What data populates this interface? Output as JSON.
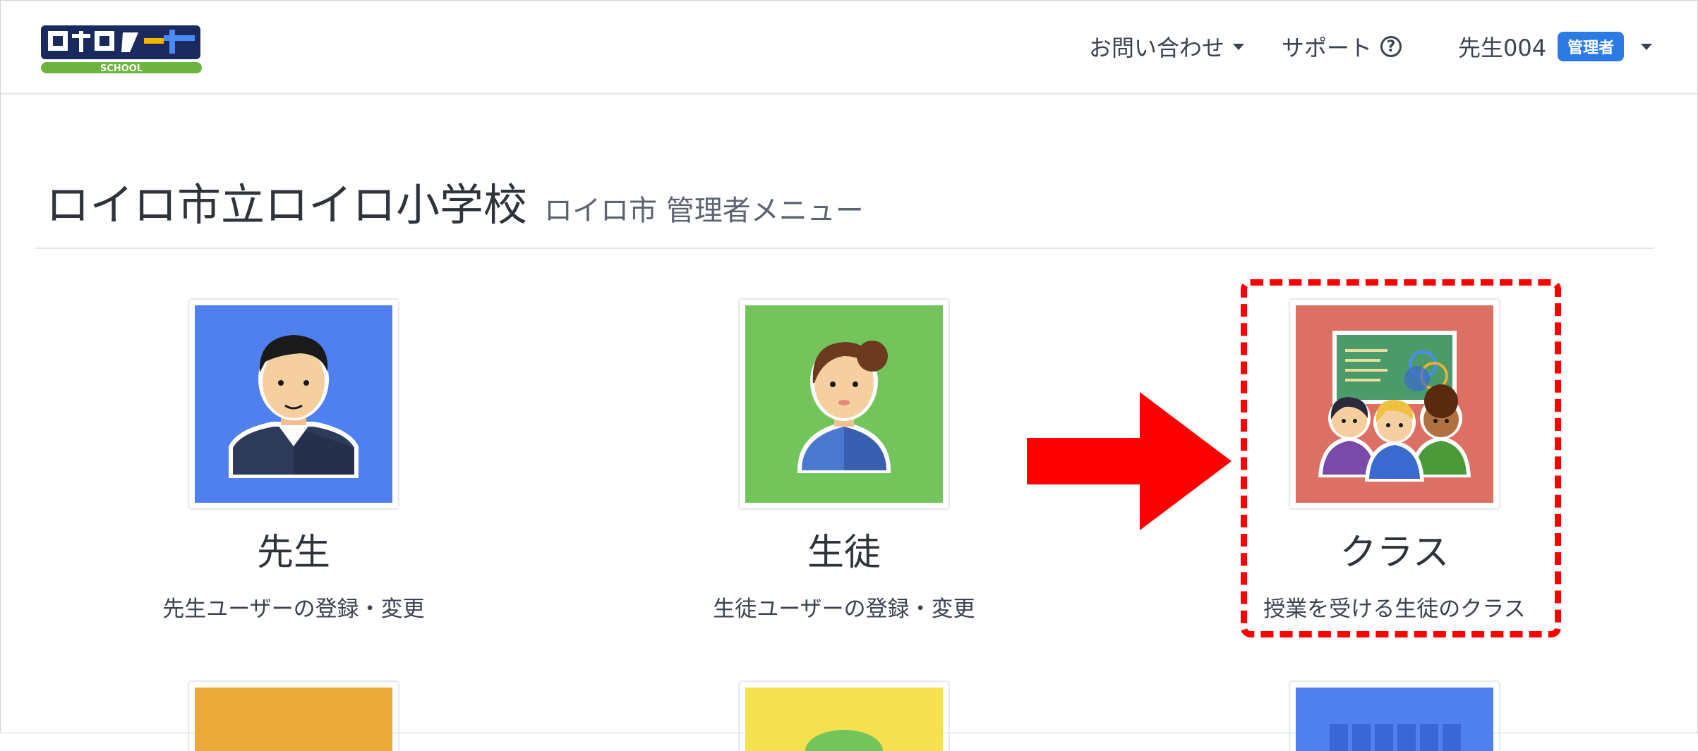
{
  "header": {
    "logo_text": "ロイロノート",
    "logo_sub": "SCHOOL",
    "contact_label": "お問い合わせ",
    "support_label": "サポート",
    "user_name": "先生004",
    "role_badge": "管理者"
  },
  "page": {
    "title": "ロイロ市立ロイロ小学校",
    "subtitle": "ロイロ市 管理者メニュー"
  },
  "cards": [
    {
      "title": "先生",
      "description": "先生ユーザーの登録・変更",
      "color": "#5080f0"
    },
    {
      "title": "生徒",
      "description": "生徒ユーザーの登録・変更",
      "color": "#74c45c"
    },
    {
      "title": "クラス",
      "description": "授業を受ける生徒のクラス",
      "color": "#dc7064"
    }
  ],
  "row2_colors": [
    "#eaaa3a",
    "#f5e050",
    "#5080f0"
  ],
  "annotation": {
    "arrow_color": "#ff0000",
    "highlight_color": "#ff0000"
  }
}
